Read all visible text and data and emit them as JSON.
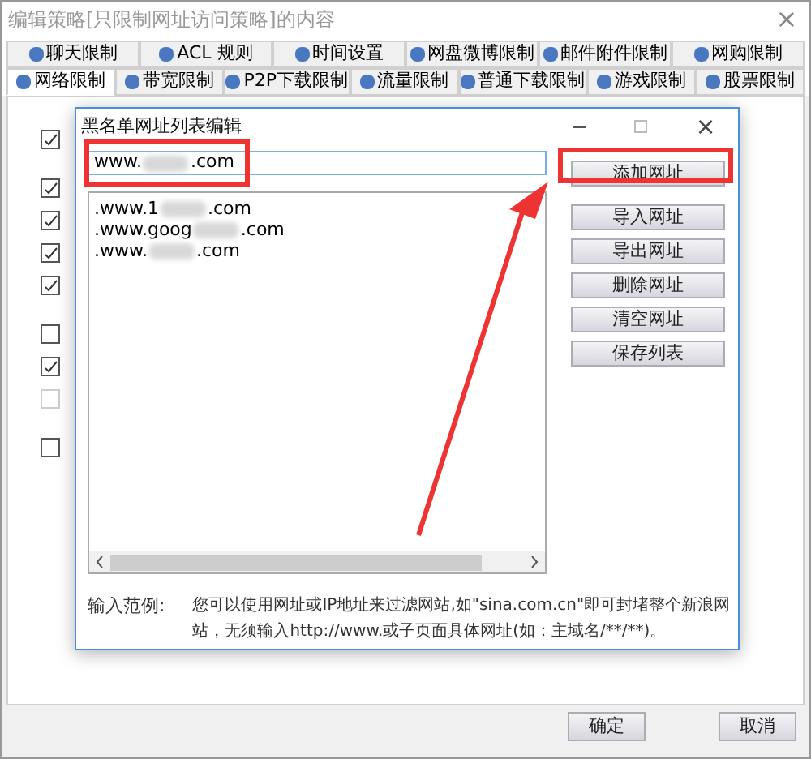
{
  "window": {
    "title": "编辑策略[只限制网址访问策略]的内容",
    "close": "×"
  },
  "tab_rows": [
    [
      {
        "label": "聊天限制",
        "selected": false
      },
      {
        "label": "ACL 规则",
        "selected": false
      },
      {
        "label": "时间设置",
        "selected": false
      },
      {
        "label": "网盘微博限制",
        "selected": false
      },
      {
        "label": "邮件附件限制",
        "selected": false
      },
      {
        "label": "网购限制",
        "selected": false
      }
    ],
    [
      {
        "label": "网络限制",
        "selected": true
      },
      {
        "label": "带宽限制",
        "selected": false
      },
      {
        "label": "P2P下载限制",
        "selected": false
      },
      {
        "label": "流量限制",
        "selected": false
      },
      {
        "label": "普通下载限制",
        "selected": false
      },
      {
        "label": "游戏限制",
        "selected": false
      },
      {
        "label": "股票限制",
        "selected": false
      }
    ]
  ],
  "background_options": [
    {
      "checked": true,
      "disabled": false
    },
    {
      "checked": true,
      "disabled": false
    },
    {
      "checked": true,
      "disabled": false
    },
    {
      "checked": true,
      "disabled": false
    },
    {
      "checked": true,
      "disabled": false
    },
    {
      "checked": false,
      "disabled": false
    },
    {
      "checked": true,
      "disabled": false
    },
    {
      "checked": false,
      "disabled": true
    },
    {
      "checked": false,
      "disabled": false
    }
  ],
  "dialog": {
    "title": "黑名单网址列表编辑",
    "close": "×",
    "url_field": {
      "prefix": "www.",
      "suffix": ".com"
    },
    "urls": [
      {
        "prefix": ".www.1",
        "suffix": ".com"
      },
      {
        "prefix": ".www.goog",
        "suffix": ".com"
      },
      {
        "prefix": ".www.",
        "suffix": ".com"
      }
    ],
    "buttons": [
      "添加网址",
      "导入网址",
      "导出网址",
      "删除网址",
      "清空网址",
      "保存列表"
    ],
    "hint_label": "输入范例:",
    "hint": "您可以使用网址或IP地址来过滤网站,如\"sina.com.cn\"即可封堵整个新浪网站，无须输入http://www.或子页面具体网址(如：主域名/**/**)。"
  },
  "footer_buttons": [
    "确定",
    "取消"
  ]
}
